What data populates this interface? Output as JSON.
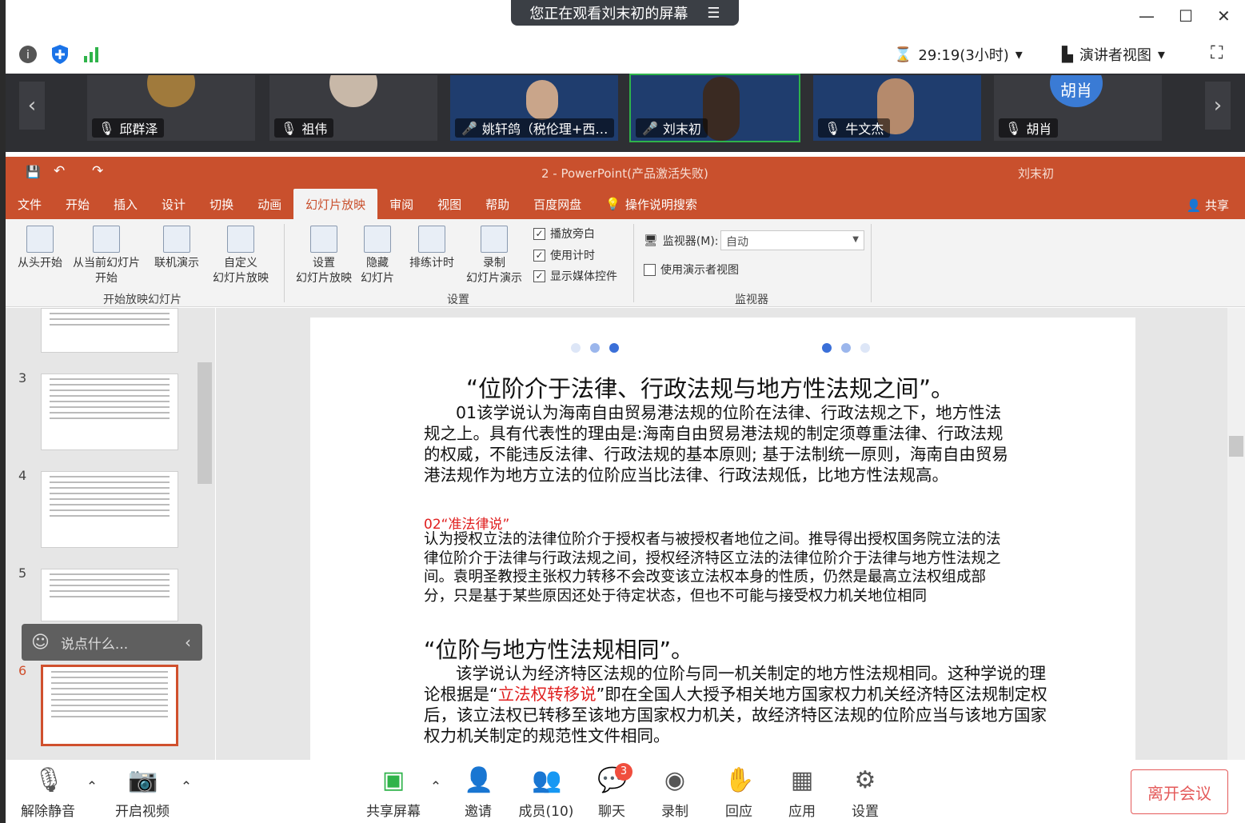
{
  "share_banner": {
    "text": "您正在观看刘末初的屏幕"
  },
  "status": {
    "timer": "29:19(3小时)",
    "view_mode": "演讲者视图"
  },
  "participants": [
    {
      "name": "邱群泽",
      "muted": true
    },
    {
      "name": "祖伟",
      "muted": true
    },
    {
      "name": "姚轩鸽（税伦理+西…",
      "muted": false
    },
    {
      "name": "刘末初",
      "muted": false,
      "active": true
    },
    {
      "name": "牛文杰",
      "muted": true
    },
    {
      "name": "胡肖",
      "muted": true,
      "avatar_text": "胡肖"
    }
  ],
  "ppt": {
    "title": "2  -  PowerPoint(产品激活失败)",
    "user": "刘末初",
    "share_label": "共享",
    "tabs": [
      "文件",
      "开始",
      "插入",
      "设计",
      "切换",
      "动画",
      "幻灯片放映",
      "审阅",
      "视图",
      "帮助",
      "百度网盘",
      "操作说明搜索"
    ],
    "selected_tab": "幻灯片放映",
    "ribbon": {
      "from_start": "从头开始",
      "from_current": "从当前幻灯片\n开始",
      "online": "联机演示",
      "custom": "自定义\n幻灯片放映",
      "group1": "开始放映幻灯片",
      "setup": "设置\n幻灯片放映",
      "hide": "隐藏\n幻灯片",
      "rehearse": "排练计时",
      "record": "录制\n幻灯片演示",
      "chk_narration": "播放旁白",
      "chk_timing": "使用计时",
      "chk_media": "显示媒体控件",
      "group2": "设置",
      "monitor_label": "监视器(M):",
      "monitor_value": "自动",
      "presenter_view": "使用演示者视图",
      "group3": "监视器"
    }
  },
  "thumbs": [
    {
      "num": "3"
    },
    {
      "num": "4"
    },
    {
      "num": "5"
    },
    {
      "num": "6"
    }
  ],
  "chat_placeholder": "说点什么...",
  "slide": {
    "heading1": "“位阶介于法律、行政法规与地方性法规之间”。",
    "para1": "01该学说认为海南自由贸易港法规的位阶在法律、行政法规之下，地方性法规之上。具有代表性的理由是:海南自由贸易港法规的制定须尊重法律、行政法规的权威，不能违反法律、行政法规的基本原则; 基于法制统一原则，海南自由贸易港法规作为地方立法的位阶应当比法律、行政法规低，比地方性法规高。",
    "sub2": "02“准法律说”",
    "para2": "认为授权立法的法律位阶介于授权者与被授权者地位之间。推导得出授权国务院立法的法律位阶介于法律与行政法规之间，授权经济特区立法的法律位阶介于法律与地方性法规之间。袁明圣教授主张权力转移不会改变该立法权本身的性质，仍然是最高立法权组成部分，只是基于某些原因还处于待定状态，但也不可能与接受权力机关地位相同",
    "heading2": "“位阶与地方性法规相同”。",
    "para3a": "该学说认为经济特区法规的位阶与同一机关制定的地方性法规相同。这种学说的理论根据是“",
    "para3red": "立法权转移说",
    "para3b": "”即在全国人大授予相关地方国家权力机关经济特区法规制定权后，该立法权已转移至该地方国家权力机关，故经济特区法规的位阶应当与该地方国家权力机关制定的规范性文件相同。"
  },
  "toolbar": {
    "unmute": "解除静音",
    "video": "开启视频",
    "share": "共享屏幕",
    "invite": "邀请",
    "members": "成员(10)",
    "chat": "聊天",
    "chat_badge": "3",
    "record": "录制",
    "react": "回应",
    "apps": "应用",
    "settings": "设置",
    "leave": "离开会议"
  }
}
